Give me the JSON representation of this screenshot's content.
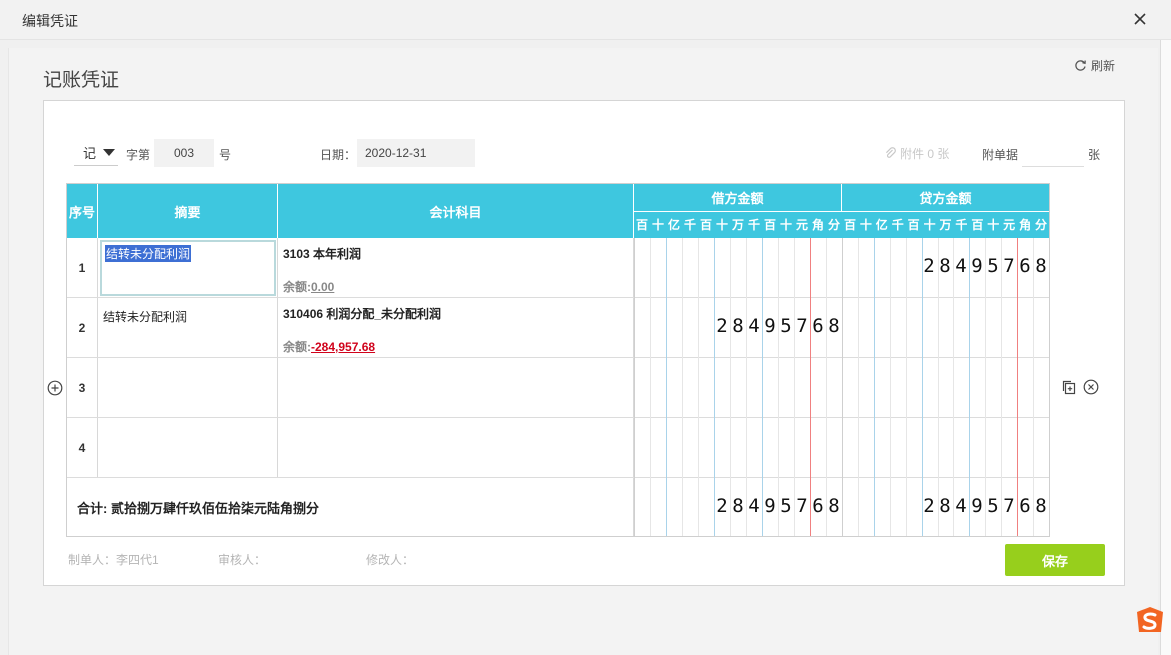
{
  "dialog": {
    "title": "编辑凭证"
  },
  "page": {
    "heading": "记账凭证",
    "refresh_label": "刷新"
  },
  "voucher": {
    "type_value": "记",
    "zi_label": "字第",
    "number": "003",
    "hao_label": "号",
    "date_label": "日期：",
    "date": "2020-12-31",
    "attachment_label": "附件 0 张",
    "bills_label": "附单据",
    "bills_value": "",
    "zhang_label": "张"
  },
  "table": {
    "headers": {
      "seq": "序号",
      "summary": "摘要",
      "account": "会计科目",
      "debit": "借方金额",
      "credit": "贷方金额"
    },
    "digit_units": [
      "百",
      "十",
      "亿",
      "千",
      "百",
      "十",
      "万",
      "千",
      "百",
      "十",
      "元",
      "角",
      "分"
    ],
    "rows": [
      {
        "seq": "1",
        "summary": "结转未分配利润",
        "account": "3103 本年利润",
        "balance_label": "余额:",
        "balance": "0.00",
        "debit": "",
        "credit": "28495768"
      },
      {
        "seq": "2",
        "summary": "结转未分配利润",
        "account": "310406 利润分配_未分配利润",
        "balance_label": "余额:",
        "balance": "-284,957.68",
        "debit": "28495768",
        "credit": ""
      },
      {
        "seq": "3",
        "summary": "",
        "account": "",
        "balance_label": "",
        "balance": "",
        "debit": "",
        "credit": ""
      },
      {
        "seq": "4",
        "summary": "",
        "account": "",
        "balance_label": "",
        "balance": "",
        "debit": "",
        "credit": ""
      }
    ],
    "total": {
      "label": "合计:  贰拾捌万肆仟玖佰伍拾柒元陆角捌分",
      "debit": "28495768",
      "credit": "28495768"
    }
  },
  "footer": {
    "maker": "制单人：李四代1",
    "reviewer": "审核人：",
    "modifier": "修改人：",
    "save_label": "保存"
  },
  "colors": {
    "header": "#3ec7df",
    "save": "#97cf1c",
    "negative": "#d0021b"
  }
}
